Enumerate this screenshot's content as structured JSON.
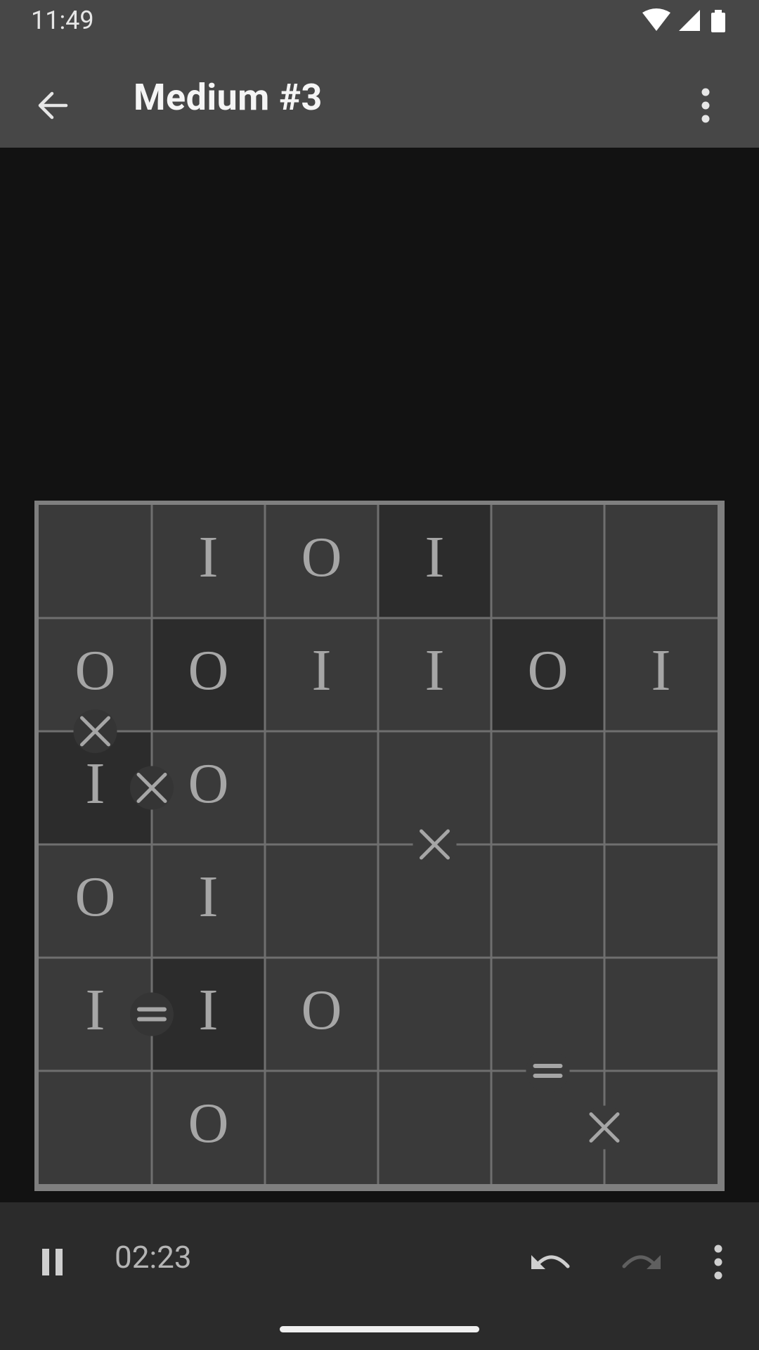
{
  "status_bar": {
    "time": "11:49"
  },
  "app_bar": {
    "title": "Medium #3",
    "back_icon": "arrow-back-icon",
    "overflow_icon": "more-vert-icon"
  },
  "board": {
    "rows": 6,
    "cols": 6,
    "cells": [
      [
        "",
        "I",
        "O",
        "I",
        "",
        ""
      ],
      [
        "O",
        "O",
        "I",
        "I",
        "O",
        "I"
      ],
      [
        "I",
        "O",
        "",
        "",
        "",
        ""
      ],
      [
        "O",
        "I",
        "",
        "",
        "",
        ""
      ],
      [
        "I",
        "I",
        "O",
        "",
        "",
        ""
      ],
      [
        "",
        "O",
        "",
        "",
        "",
        ""
      ]
    ],
    "highlighted_cells": [
      [
        0,
        3
      ],
      [
        1,
        1
      ],
      [
        1,
        4
      ],
      [
        2,
        0
      ],
      [
        4,
        1
      ]
    ],
    "constraints": [
      {
        "type": "x",
        "between": [
          [
            1,
            0
          ],
          [
            2,
            0
          ]
        ],
        "marker_bg": true
      },
      {
        "type": "x",
        "between": [
          [
            2,
            0
          ],
          [
            2,
            1
          ]
        ],
        "marker_bg": true
      },
      {
        "type": "x",
        "between": [
          [
            2,
            3
          ],
          [
            3,
            3
          ]
        ],
        "marker_bg": false
      },
      {
        "type": "=",
        "between": [
          [
            4,
            0
          ],
          [
            4,
            1
          ]
        ],
        "marker_bg": true
      },
      {
        "type": "=",
        "between": [
          [
            4,
            4
          ],
          [
            5,
            4
          ]
        ],
        "marker_bg": false
      },
      {
        "type": "x",
        "between": [
          [
            5,
            4
          ],
          [
            5,
            5
          ]
        ],
        "marker_bg": false
      }
    ],
    "colors": {
      "cell": "#3a3a3a",
      "cell_highlight": "#2c2c2c",
      "grid_line": "#6f6f6f",
      "border": "#7f7f7f",
      "symbol": "#a6a6a6",
      "marker_bg": "#353535"
    }
  },
  "bottom_bar": {
    "timer": "02:23",
    "pause_icon": "pause-icon",
    "undo_icon": "undo-icon",
    "redo_icon": "redo-icon",
    "more_icon": "more-vert-icon"
  }
}
